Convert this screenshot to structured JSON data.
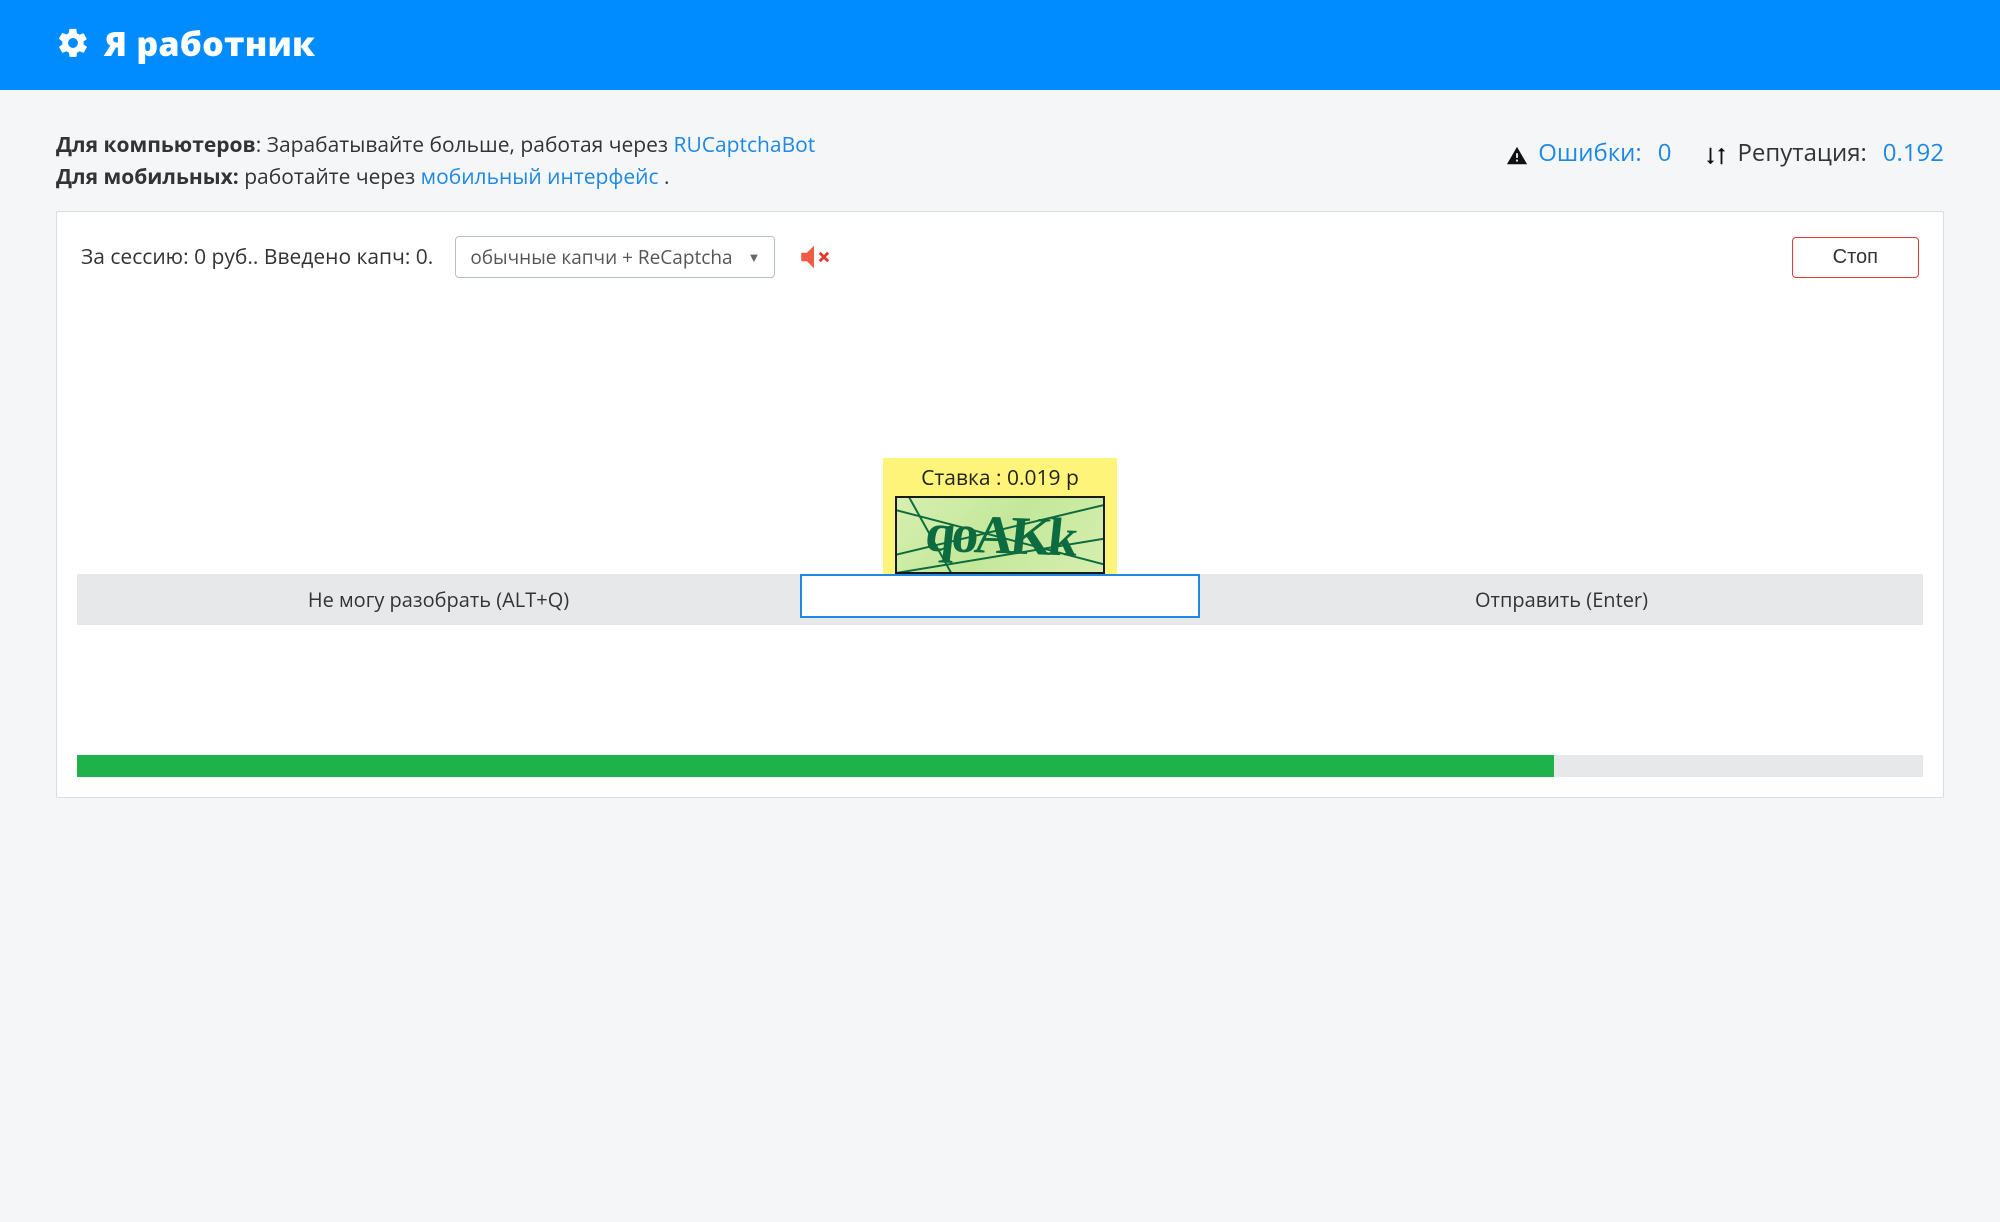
{
  "header": {
    "title": "Я работник"
  },
  "info": {
    "desktop_label": "Для компьютеров",
    "desktop_text": ": Зарабатывайте больше, работая через ",
    "desktop_link": "RUCaptchaBot",
    "mobile_label": "Для мобильных:",
    "mobile_text": " работайте через ",
    "mobile_link": "мобильный интерфейс",
    "mobile_text_after": " ."
  },
  "stats": {
    "errors_label": "Ошибки:",
    "errors_value": "0",
    "reputation_label": "Репутация:",
    "reputation_value": "0.192"
  },
  "session": {
    "earned_label": "За сессию:",
    "earned_value": "0 руб.",
    "entered_label": "Введено капч:",
    "entered_value": "0",
    "combined": "За сессию: 0 руб.. Введено капч: 0."
  },
  "mode_select": {
    "selected": "обычные капчи + ReCaptcha"
  },
  "buttons": {
    "stop": "Стоп",
    "cant_read": "Не могу разобрать (ALT+Q)",
    "submit": "Отправить (Enter)"
  },
  "captcha": {
    "rate_combined": "Ставка : 0.019 р",
    "input_value": ""
  },
  "progress": {
    "percent": 80
  },
  "colors": {
    "accent": "#008cff",
    "link": "#1e88e5",
    "danger": "#e53935",
    "green": "#1fb24a",
    "highlight": "#fff47a"
  }
}
